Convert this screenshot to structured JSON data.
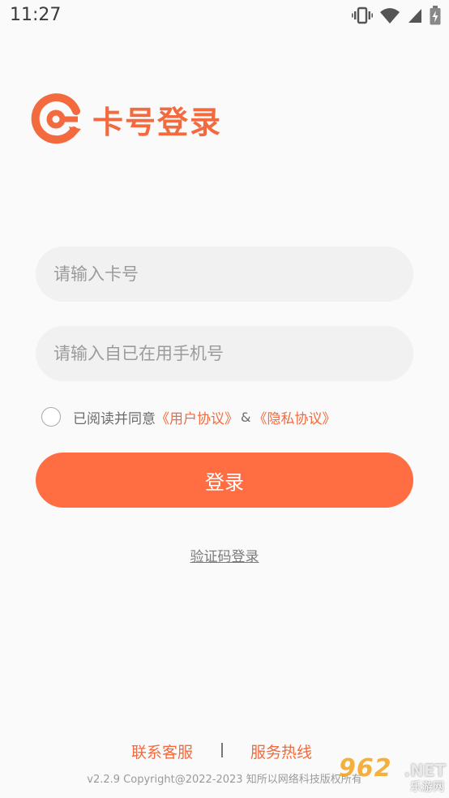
{
  "status_bar": {
    "time": "11:27",
    "icons": [
      "vibrate-icon",
      "wifi-icon",
      "signal-icon",
      "battery-icon"
    ]
  },
  "brand": {
    "title": "卡号登录",
    "logo_icon": "brand-logo-icon",
    "accent_color": "#f26a3e"
  },
  "form": {
    "card_placeholder": "请输入卡号",
    "card_value": "",
    "phone_placeholder": "请输入自已在用手机号",
    "phone_value": "",
    "agreement": {
      "checked": false,
      "prefix": "已阅读并同意",
      "user_agreement": "《用户协议》",
      "amp": "&",
      "privacy_agreement": "《隐私协议》"
    },
    "login_label": "登录",
    "login_color": "#ff6e43",
    "sms_login_label": "验证码登录"
  },
  "footer": {
    "contact_label": "联系客服",
    "divider": "|",
    "hotline_label": "服务热线",
    "copyright": "v2.2.9 Copyright@2022-2023 知所以网络科技版权所有"
  },
  "watermark": {
    "main": "962",
    "domain": ".NET",
    "sub": "乐游网"
  }
}
